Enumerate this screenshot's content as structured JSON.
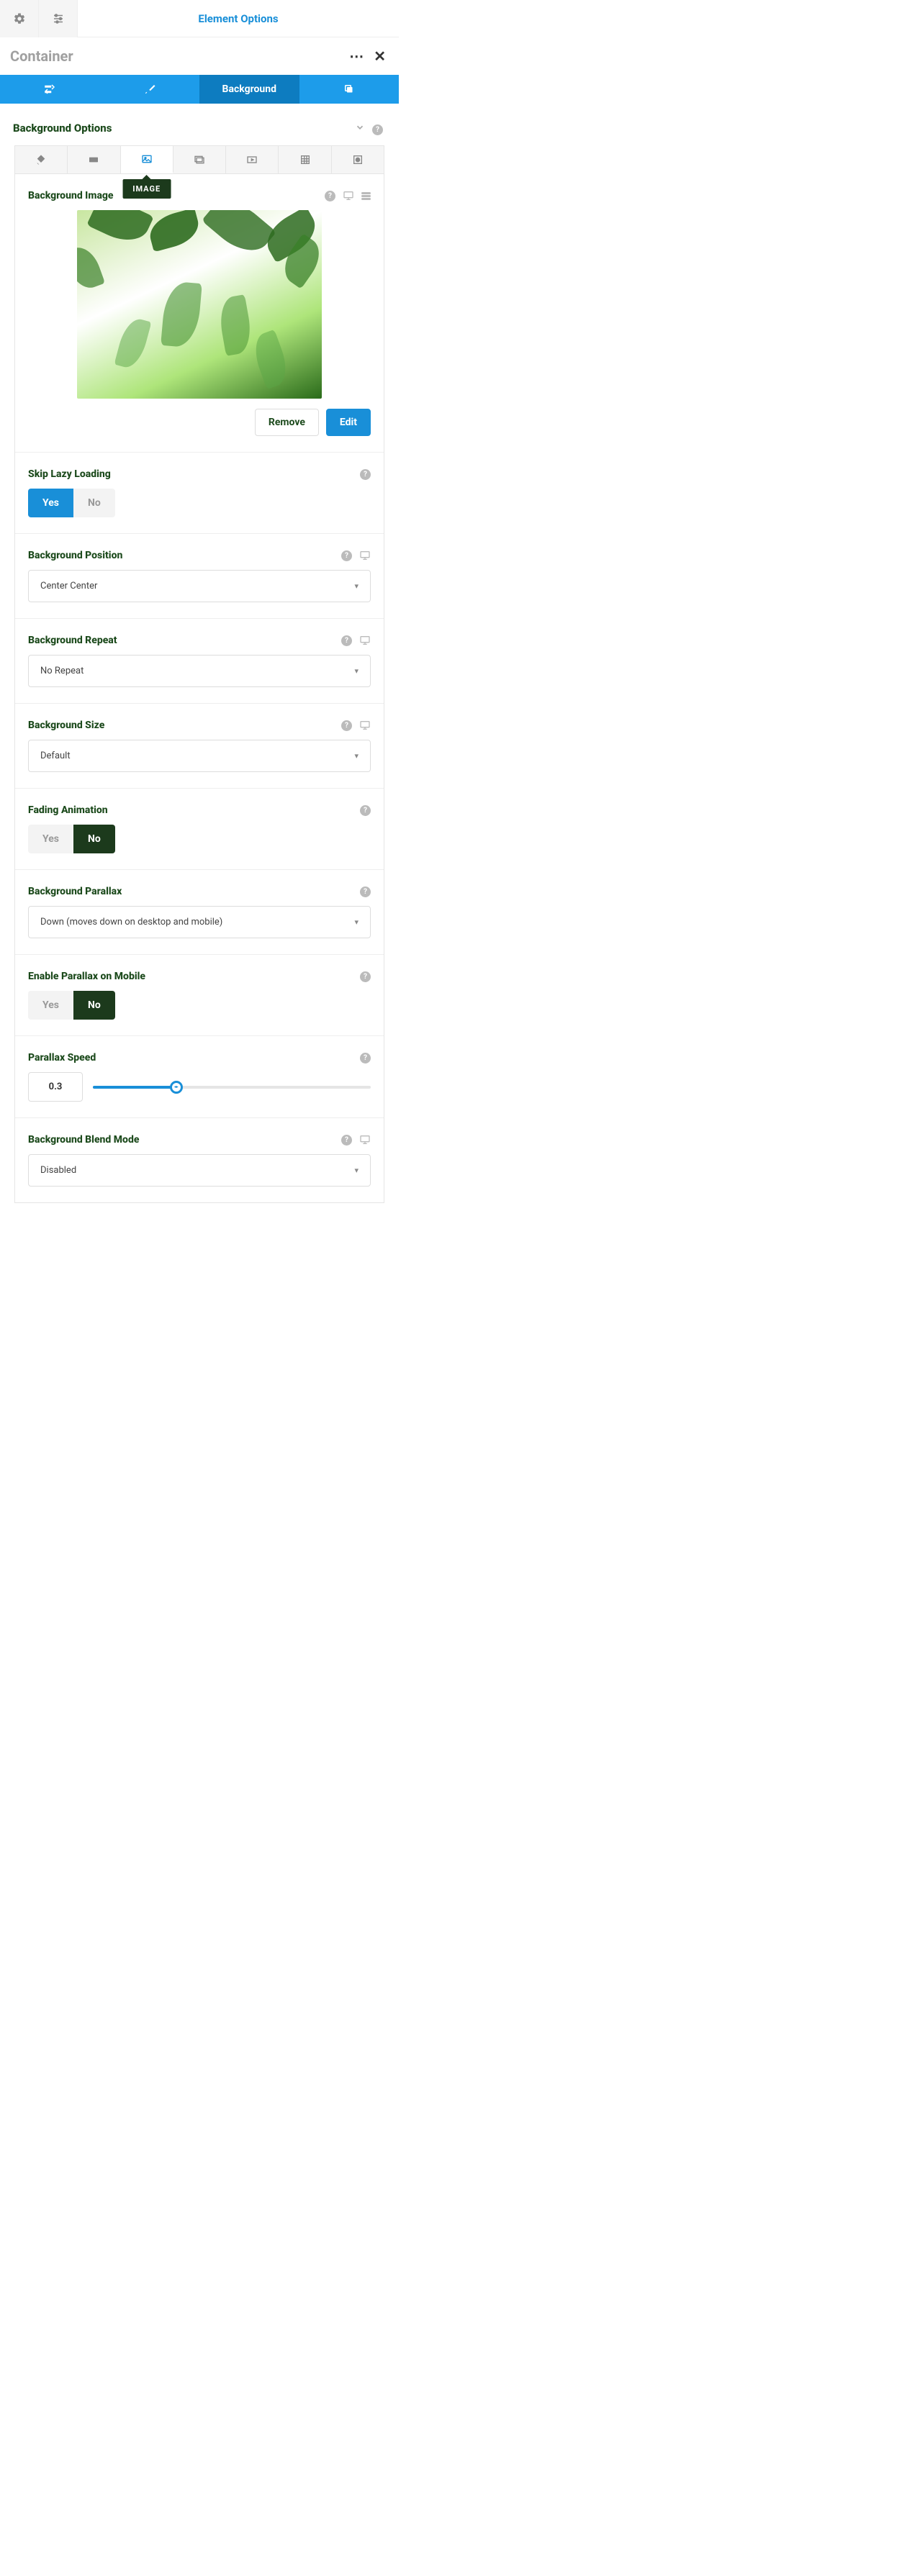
{
  "top": {
    "title": "Element Options"
  },
  "header": {
    "title": "Container"
  },
  "tabs": {
    "background": "Background"
  },
  "section": {
    "title": "Background Options"
  },
  "subtab_tooltip": "IMAGE",
  "bg_image": {
    "label": "Background Image",
    "remove": "Remove",
    "edit": "Edit"
  },
  "skip_lazy": {
    "label": "Skip Lazy Loading",
    "yes": "Yes",
    "no": "No"
  },
  "bg_position": {
    "label": "Background Position",
    "value": "Center Center"
  },
  "bg_repeat": {
    "label": "Background Repeat",
    "value": "No Repeat"
  },
  "bg_size": {
    "label": "Background Size",
    "value": "Default"
  },
  "fading": {
    "label": "Fading Animation",
    "yes": "Yes",
    "no": "No"
  },
  "parallax": {
    "label": "Background Parallax",
    "value": "Down (moves down on desktop and mobile)"
  },
  "parallax_mobile": {
    "label": "Enable Parallax on Mobile",
    "yes": "Yes",
    "no": "No"
  },
  "parallax_speed": {
    "label": "Parallax Speed",
    "value": "0.3"
  },
  "blend": {
    "label": "Background Blend Mode",
    "value": "Disabled"
  }
}
